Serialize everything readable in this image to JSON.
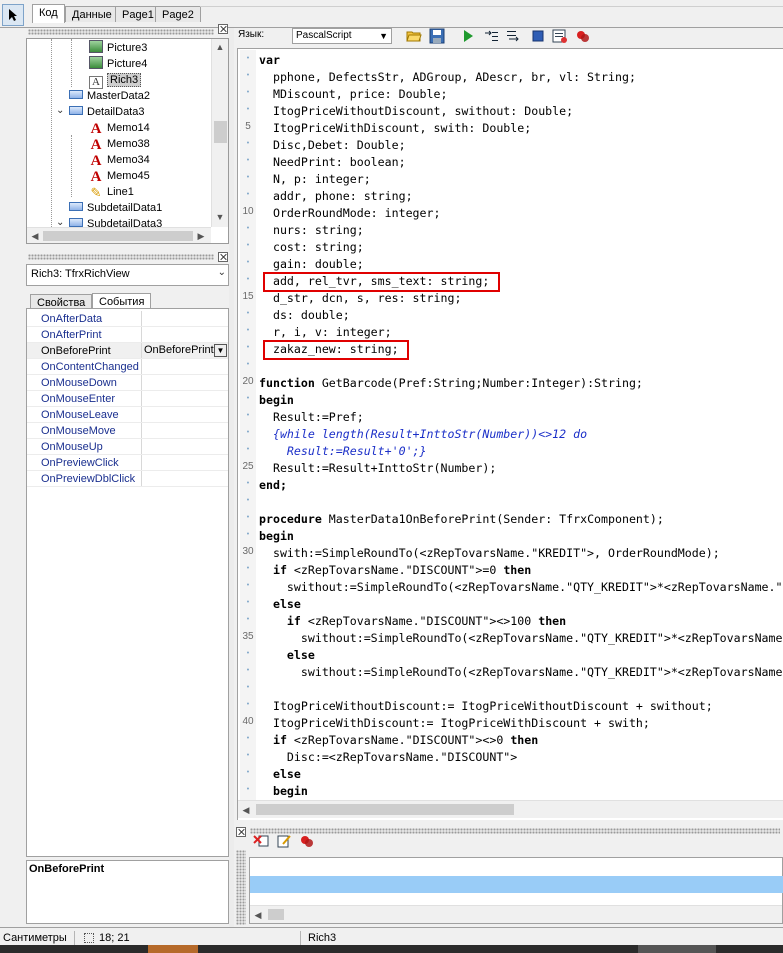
{
  "top_tabs": [
    {
      "label": "Код",
      "active": true
    },
    {
      "label": "Данные",
      "active": false
    },
    {
      "label": "Page1",
      "active": false
    },
    {
      "label": "Page2",
      "active": false
    }
  ],
  "tree": {
    "items": [
      {
        "label": "Picture3",
        "icon": "picture-icon",
        "level": 3
      },
      {
        "label": "Picture4",
        "icon": "picture-icon",
        "level": 3
      },
      {
        "label": "Rich3",
        "icon": "rich-text-icon",
        "level": 3,
        "selected": true
      },
      {
        "label": "MasterData2",
        "icon": "band-icon",
        "level": 2
      },
      {
        "label": "DetailData3",
        "icon": "band-icon",
        "level": 2,
        "expanded": true
      },
      {
        "label": "Memo14",
        "icon": "memo-icon",
        "level": 3
      },
      {
        "label": "Memo38",
        "icon": "memo-icon",
        "level": 3
      },
      {
        "label": "Memo34",
        "icon": "memo-icon",
        "level": 3
      },
      {
        "label": "Memo45",
        "icon": "memo-icon",
        "level": 3
      },
      {
        "label": "Line1",
        "icon": "line-icon",
        "level": 3
      },
      {
        "label": "SubdetailData1",
        "icon": "band-icon",
        "level": 2
      },
      {
        "label": "SubdetailData3",
        "icon": "band-icon",
        "level": 2,
        "expanded": true
      }
    ]
  },
  "object_combo": {
    "value": "Rich3: TfrxRichView"
  },
  "props_tabs": [
    {
      "label": "Свойства",
      "active": false
    },
    {
      "label": "События",
      "active": true
    }
  ],
  "events": [
    {
      "name": "OnAfterData",
      "value": ""
    },
    {
      "name": "OnAfterPrint",
      "value": ""
    },
    {
      "name": "OnBeforePrint",
      "value": "OnBeforePrint",
      "selected": true
    },
    {
      "name": "OnContentChanged",
      "value": ""
    },
    {
      "name": "OnMouseDown",
      "value": ""
    },
    {
      "name": "OnMouseEnter",
      "value": ""
    },
    {
      "name": "OnMouseLeave",
      "value": ""
    },
    {
      "name": "OnMouseMove",
      "value": ""
    },
    {
      "name": "OnMouseUp",
      "value": ""
    },
    {
      "name": "OnPreviewClick",
      "value": ""
    },
    {
      "name": "OnPreviewDblClick",
      "value": ""
    }
  ],
  "description": {
    "title": "OnBeforePrint"
  },
  "editor_toolbar": {
    "lang_label": "Язык:",
    "lang_value": "PascalScript",
    "icons": [
      "open-icon",
      "save-icon",
      "run-icon",
      "step-into-icon",
      "step-over-icon",
      "stop-icon",
      "evaluate-icon",
      "breakpoint-icon"
    ]
  },
  "gutter": [
    {
      "line": 1,
      "text": ""
    },
    {
      "line": 2,
      "text": ""
    },
    {
      "line": 3,
      "text": ""
    },
    {
      "line": 4,
      "text": ""
    },
    {
      "line": 5,
      "text": "5"
    },
    {
      "line": 6,
      "text": ""
    },
    {
      "line": 7,
      "text": ""
    },
    {
      "line": 8,
      "text": ""
    },
    {
      "line": 9,
      "text": ""
    },
    {
      "line": 10,
      "text": "10"
    },
    {
      "line": 11,
      "text": ""
    },
    {
      "line": 12,
      "text": ""
    },
    {
      "line": 13,
      "text": ""
    },
    {
      "line": 14,
      "text": ""
    },
    {
      "line": 15,
      "text": "15"
    },
    {
      "line": 16,
      "text": ""
    },
    {
      "line": 17,
      "text": ""
    },
    {
      "line": 18,
      "text": ""
    },
    {
      "line": 19,
      "text": ""
    },
    {
      "line": 20,
      "text": "20"
    },
    {
      "line": 21,
      "text": ""
    },
    {
      "line": 22,
      "text": ""
    },
    {
      "line": 23,
      "text": ""
    },
    {
      "line": 24,
      "text": ""
    },
    {
      "line": 25,
      "text": "25"
    },
    {
      "line": 26,
      "text": ""
    },
    {
      "line": 27,
      "text": ""
    },
    {
      "line": 28,
      "text": ""
    },
    {
      "line": 29,
      "text": ""
    },
    {
      "line": 30,
      "text": "30"
    },
    {
      "line": 31,
      "text": ""
    },
    {
      "line": 32,
      "text": ""
    },
    {
      "line": 33,
      "text": ""
    },
    {
      "line": 34,
      "text": ""
    },
    {
      "line": 35,
      "text": "35"
    },
    {
      "line": 36,
      "text": ""
    },
    {
      "line": 37,
      "text": ""
    },
    {
      "line": 38,
      "text": ""
    },
    {
      "line": 39,
      "text": ""
    },
    {
      "line": 40,
      "text": "40"
    },
    {
      "line": 41,
      "text": ""
    },
    {
      "line": 42,
      "text": ""
    },
    {
      "line": 43,
      "text": ""
    },
    {
      "line": 44,
      "text": ""
    }
  ],
  "code_lines": [
    {
      "text": "var",
      "kw": true
    },
    {
      "text": "  pphone, DefectsStr, ADGroup, ADescr, br, vl: String;"
    },
    {
      "text": "  MDiscount, price: Double;"
    },
    {
      "text": "  ItogPriceWithoutDiscount, swithout: Double;"
    },
    {
      "text": "  ItogPriceWithDiscount, swith: Double;"
    },
    {
      "text": "  Disc,Debet: Double;"
    },
    {
      "text": "  NeedPrint: boolean;"
    },
    {
      "text": "  N, p: integer;"
    },
    {
      "text": "  addr, phone: string;"
    },
    {
      "text": "  OrderRoundMode: integer;"
    },
    {
      "text": "  nurs: string;"
    },
    {
      "text": "  cost: string;"
    },
    {
      "text": "  gain: double;"
    },
    {
      "text": "  add, rel_tvr, sms_text: string;",
      "boxed": true
    },
    {
      "text": "  d_str, dcn, s, res: string;"
    },
    {
      "text": "  ds: double;"
    },
    {
      "text": "  r, i, v: integer;"
    },
    {
      "text": "  zakaz_new: string;",
      "boxed": true
    },
    {
      "text": ""
    },
    {
      "text": "function GetBarcode(Pref:String;Number:Integer):String;",
      "kwprefix": "function"
    },
    {
      "text": "begin",
      "kw": true
    },
    {
      "text": "  Result:=Pref;"
    },
    {
      "text": "  {while length(Result+InttoStr(Number))<>12 do",
      "comment": true
    },
    {
      "text": "    Result:=Result+'0';}",
      "comment": true
    },
    {
      "text": "  Result:=Result+InttoStr(Number);"
    },
    {
      "text": "end;",
      "kw": true
    },
    {
      "text": ""
    },
    {
      "text": "procedure MasterData1OnBeforePrint(Sender: TfrxComponent);",
      "kwprefix": "procedure"
    },
    {
      "text": "begin",
      "kw": true
    },
    {
      "text": "  swith:=SimpleRoundTo(<zRepTovarsName.\"KREDIT\">, OrderRoundMode);"
    },
    {
      "text": "  if <zRepTovarsName.\"DISCOUNT\">=0 then",
      "kwwords": [
        "if",
        "then"
      ]
    },
    {
      "text": "    swithout:=SimpleRoundTo(<zRepTovarsName.\"QTY_KREDIT\">*<zRepTovarsName.\"PRICE\">, OrderRoundMode)"
    },
    {
      "text": "  else",
      "kw": true
    },
    {
      "text": "    if <zRepTovarsName.\"DISCOUNT\"><>100 then",
      "kwwords": [
        "if",
        "then"
      ]
    },
    {
      "text": "      swithout:=SimpleRoundTo(<zRepTovarsName.\"QTY_KREDIT\">*<zRepTovarsName.\"KREDIT\">, OrderRoundMode)"
    },
    {
      "text": "    else",
      "kw": true
    },
    {
      "text": "      swithout:=SimpleRoundTo(<zRepTovarsName.\"QTY_KREDIT\">*<zRepTovarsName.\"PRICE\">, OrderRoundMode)"
    },
    {
      "text": ""
    },
    {
      "text": "  ItogPriceWithoutDiscount:= ItogPriceWithoutDiscount + swithout;"
    },
    {
      "text": "  ItogPriceWithDiscount:= ItogPriceWithDiscount + swith;"
    },
    {
      "text": "  if <zRepTovarsName.\"DISCOUNT\"><>0 then",
      "kwwords": [
        "if",
        "then"
      ]
    },
    {
      "text": "    Disc:=<zRepTovarsName.\"DISCOUNT\">"
    },
    {
      "text": "  else",
      "kw": true
    },
    {
      "text": "  begin",
      "kw": true
    }
  ],
  "log_toolbar": {
    "icons": [
      "clear-icon",
      "edit-icon",
      "breakpoint-icon"
    ]
  },
  "status_bar": {
    "units": "Сантиметры",
    "coords": "18; 21",
    "object": "Rich3"
  }
}
